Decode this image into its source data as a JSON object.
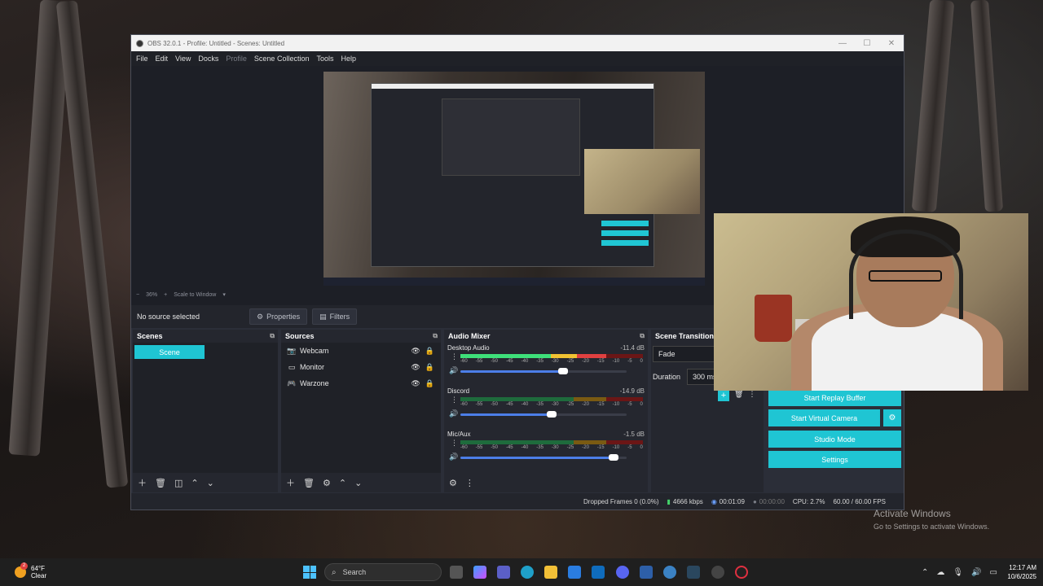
{
  "window": {
    "title": "OBS 32.0.1 - Profile: Untitled - Scenes: Untitled",
    "controls": [
      "—",
      "☐",
      "✕"
    ]
  },
  "menu": [
    "File",
    "Edit",
    "View",
    "Docks",
    "Profile",
    "Scene Collection",
    "Tools",
    "Help"
  ],
  "zoom": {
    "minus": "−",
    "value": "36%",
    "plus": "+",
    "mode": "Scale to Window"
  },
  "source_toolbar": {
    "status": "No source selected",
    "properties": "Properties",
    "filters": "Filters"
  },
  "scenes": {
    "title": "Scenes",
    "items": [
      "Scene"
    ]
  },
  "sources": {
    "title": "Sources",
    "items": [
      {
        "name": "Webcam",
        "icon": "camera-icon"
      },
      {
        "name": "Monitor",
        "icon": "monitor-icon"
      },
      {
        "name": "Warzone",
        "icon": "gamepad-icon"
      }
    ]
  },
  "mixer": {
    "title": "Audio Mixer",
    "scale": [
      "-60",
      "-55",
      "-50",
      "-45",
      "-40",
      "-35",
      "-30",
      "-25",
      "-20",
      "-15",
      "-10",
      "-5",
      "0"
    ],
    "channels": [
      {
        "name": "Desktop Audio",
        "db": "-11.4 dB",
        "level": 0.8,
        "volume": 0.62
      },
      {
        "name": "Discord",
        "db": "-14.9 dB",
        "level": 0.0,
        "volume": 0.55
      },
      {
        "name": "Mic/Aux",
        "db": "-1.5 dB",
        "level": 0.0,
        "volume": 0.92
      }
    ]
  },
  "transitions": {
    "title": "Scene Transitions",
    "value": "Fade",
    "duration_label": "Duration",
    "duration_value": "300 ms"
  },
  "controls": {
    "replay": "Start Replay Buffer",
    "virtual_cam": "Start Virtual Camera",
    "studio": "Studio Mode",
    "settings": "Settings"
  },
  "status": {
    "dropped": "Dropped Frames 0 (0.0%)",
    "bitrate": "4666 kbps",
    "stream_time": "00:01:09",
    "rec_time": "00:00:00",
    "cpu": "CPU: 2.7%",
    "fps": "60.00 / 60.00 FPS"
  },
  "activation": {
    "line1": "Activate Windows",
    "line2": "Go to Settings to activate Windows."
  },
  "taskbar": {
    "weather_temp": "64°F",
    "weather_desc": "Clear",
    "weather_badge": "2",
    "search": "Search",
    "time": "12:17 AM",
    "date": "10/6/2025"
  },
  "colors": {
    "accent": "#1fc5d3",
    "meter_green": "#3ee07a",
    "slider": "#4c7ee8"
  }
}
